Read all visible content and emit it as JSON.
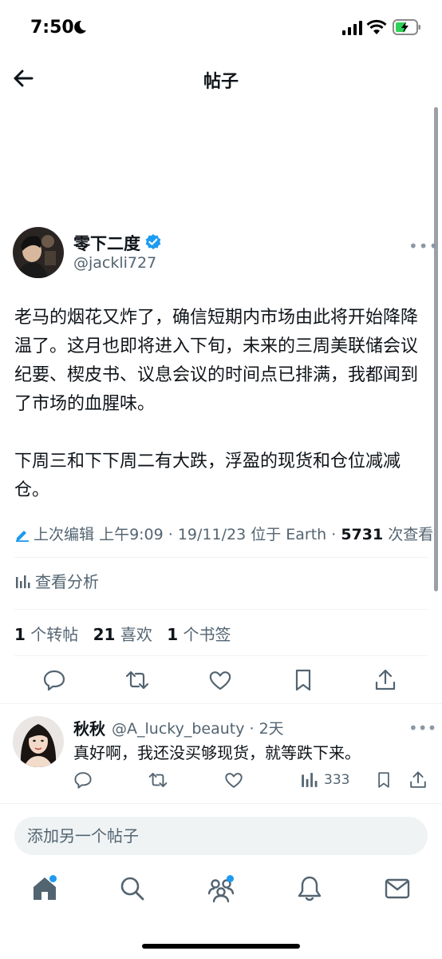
{
  "status_bar": {
    "time": "7:50"
  },
  "header": {
    "title": "帖子"
  },
  "post": {
    "author_name": "零下二度",
    "author_handle": "@jackli727",
    "paragraphs": [
      "老马的烟花又炸了，确信短期内市场由此将开始降降温了。这月也即将进入下旬，未来的三周美联储会议纪要、楔皮书、议息会议的时间点已排满，我都闻到了市场的血腥味。",
      "下周三和下下周二有大跌，浮盈的现货和仓位减减仓。"
    ],
    "edit_label": "上次编辑",
    "edit_time": "上午9:09 · 19/11/23",
    "location": "位于 Earth",
    "views_count": "5731",
    "views_label": "次查看",
    "analytics_label": "查看分析",
    "reposts_count": "1",
    "reposts_label": "个转帖",
    "likes_count": "21",
    "likes_label": "喜欢",
    "bookmarks_count": "1",
    "bookmarks_label": "个书签"
  },
  "reply": {
    "name": "秋秋",
    "handle": "@A_lucky_beauty",
    "time": "2天",
    "text": "真好啊，我还没买够现货，就等跌下来。",
    "views": "333"
  },
  "compose": {
    "placeholder": "添加另一个帖子"
  },
  "colors": {
    "accent": "#1d9bf0",
    "text": "#0f1419",
    "secondary": "#536471"
  }
}
